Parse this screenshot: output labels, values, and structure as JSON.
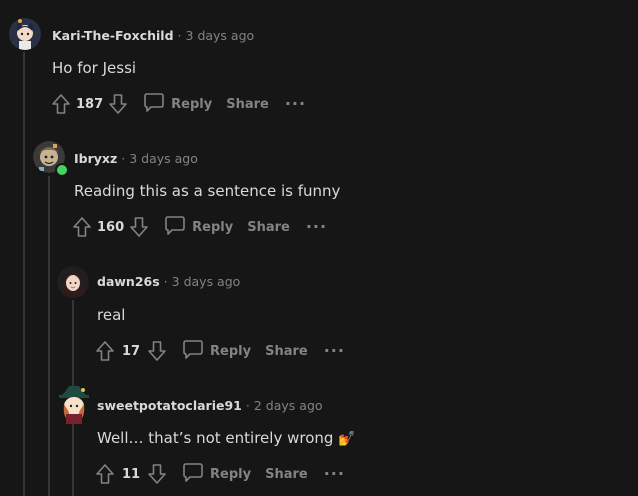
{
  "comments": [
    {
      "author": "Kari-The-Foxchild",
      "separator": "·",
      "time": "3 days ago",
      "body": "Ho for Jessi",
      "score": "187",
      "reply_label": "Reply",
      "share_label": "Share",
      "more_label": "···"
    },
    {
      "author": "Ibryxz",
      "separator": "·",
      "time": "3 days ago",
      "body": "Reading this as a sentence is funny",
      "score": "160",
      "reply_label": "Reply",
      "share_label": "Share",
      "more_label": "···"
    },
    {
      "author": "dawn26s",
      "separator": "·",
      "time": "3 days ago",
      "body": "real",
      "score": "17",
      "reply_label": "Reply",
      "share_label": "Share",
      "more_label": "···"
    },
    {
      "author": "sweetpotatoclarie91",
      "separator": "·",
      "time": "2 days ago",
      "body": "Well… that’s not entirely wrong",
      "emoji": "💅",
      "score": "11",
      "reply_label": "Reply",
      "share_label": "Share",
      "more_label": "···"
    }
  ],
  "colors": {
    "background": "#161617",
    "text": "#d7dadc",
    "muted": "#818384",
    "thread_line": "#343536",
    "online": "#46d160"
  },
  "icons": [
    "upvote-icon",
    "downvote-icon",
    "comment-bubble-icon",
    "more-icon"
  ]
}
